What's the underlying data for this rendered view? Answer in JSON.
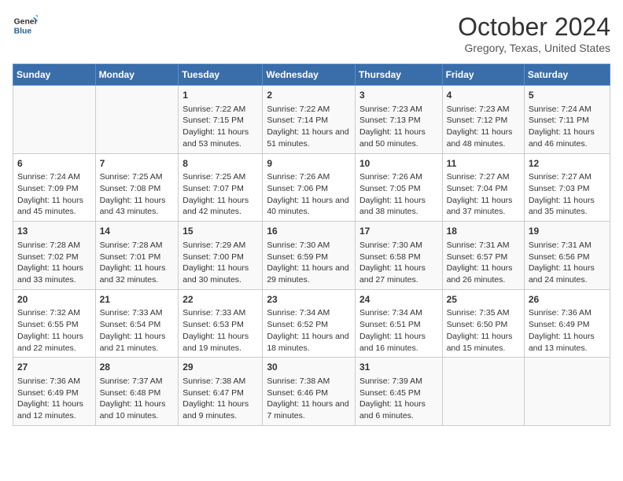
{
  "header": {
    "logo_line1": "General",
    "logo_line2": "Blue",
    "month": "October 2024",
    "location": "Gregory, Texas, United States"
  },
  "columns": [
    "Sunday",
    "Monday",
    "Tuesday",
    "Wednesday",
    "Thursday",
    "Friday",
    "Saturday"
  ],
  "weeks": [
    [
      {
        "day": "",
        "content": ""
      },
      {
        "day": "",
        "content": ""
      },
      {
        "day": "1",
        "content": "Sunrise: 7:22 AM\nSunset: 7:15 PM\nDaylight: 11 hours and 53 minutes."
      },
      {
        "day": "2",
        "content": "Sunrise: 7:22 AM\nSunset: 7:14 PM\nDaylight: 11 hours and 51 minutes."
      },
      {
        "day": "3",
        "content": "Sunrise: 7:23 AM\nSunset: 7:13 PM\nDaylight: 11 hours and 50 minutes."
      },
      {
        "day": "4",
        "content": "Sunrise: 7:23 AM\nSunset: 7:12 PM\nDaylight: 11 hours and 48 minutes."
      },
      {
        "day": "5",
        "content": "Sunrise: 7:24 AM\nSunset: 7:11 PM\nDaylight: 11 hours and 46 minutes."
      }
    ],
    [
      {
        "day": "6",
        "content": "Sunrise: 7:24 AM\nSunset: 7:09 PM\nDaylight: 11 hours and 45 minutes."
      },
      {
        "day": "7",
        "content": "Sunrise: 7:25 AM\nSunset: 7:08 PM\nDaylight: 11 hours and 43 minutes."
      },
      {
        "day": "8",
        "content": "Sunrise: 7:25 AM\nSunset: 7:07 PM\nDaylight: 11 hours and 42 minutes."
      },
      {
        "day": "9",
        "content": "Sunrise: 7:26 AM\nSunset: 7:06 PM\nDaylight: 11 hours and 40 minutes."
      },
      {
        "day": "10",
        "content": "Sunrise: 7:26 AM\nSunset: 7:05 PM\nDaylight: 11 hours and 38 minutes."
      },
      {
        "day": "11",
        "content": "Sunrise: 7:27 AM\nSunset: 7:04 PM\nDaylight: 11 hours and 37 minutes."
      },
      {
        "day": "12",
        "content": "Sunrise: 7:27 AM\nSunset: 7:03 PM\nDaylight: 11 hours and 35 minutes."
      }
    ],
    [
      {
        "day": "13",
        "content": "Sunrise: 7:28 AM\nSunset: 7:02 PM\nDaylight: 11 hours and 33 minutes."
      },
      {
        "day": "14",
        "content": "Sunrise: 7:28 AM\nSunset: 7:01 PM\nDaylight: 11 hours and 32 minutes."
      },
      {
        "day": "15",
        "content": "Sunrise: 7:29 AM\nSunset: 7:00 PM\nDaylight: 11 hours and 30 minutes."
      },
      {
        "day": "16",
        "content": "Sunrise: 7:30 AM\nSunset: 6:59 PM\nDaylight: 11 hours and 29 minutes."
      },
      {
        "day": "17",
        "content": "Sunrise: 7:30 AM\nSunset: 6:58 PM\nDaylight: 11 hours and 27 minutes."
      },
      {
        "day": "18",
        "content": "Sunrise: 7:31 AM\nSunset: 6:57 PM\nDaylight: 11 hours and 26 minutes."
      },
      {
        "day": "19",
        "content": "Sunrise: 7:31 AM\nSunset: 6:56 PM\nDaylight: 11 hours and 24 minutes."
      }
    ],
    [
      {
        "day": "20",
        "content": "Sunrise: 7:32 AM\nSunset: 6:55 PM\nDaylight: 11 hours and 22 minutes."
      },
      {
        "day": "21",
        "content": "Sunrise: 7:33 AM\nSunset: 6:54 PM\nDaylight: 11 hours and 21 minutes."
      },
      {
        "day": "22",
        "content": "Sunrise: 7:33 AM\nSunset: 6:53 PM\nDaylight: 11 hours and 19 minutes."
      },
      {
        "day": "23",
        "content": "Sunrise: 7:34 AM\nSunset: 6:52 PM\nDaylight: 11 hours and 18 minutes."
      },
      {
        "day": "24",
        "content": "Sunrise: 7:34 AM\nSunset: 6:51 PM\nDaylight: 11 hours and 16 minutes."
      },
      {
        "day": "25",
        "content": "Sunrise: 7:35 AM\nSunset: 6:50 PM\nDaylight: 11 hours and 15 minutes."
      },
      {
        "day": "26",
        "content": "Sunrise: 7:36 AM\nSunset: 6:49 PM\nDaylight: 11 hours and 13 minutes."
      }
    ],
    [
      {
        "day": "27",
        "content": "Sunrise: 7:36 AM\nSunset: 6:49 PM\nDaylight: 11 hours and 12 minutes."
      },
      {
        "day": "28",
        "content": "Sunrise: 7:37 AM\nSunset: 6:48 PM\nDaylight: 11 hours and 10 minutes."
      },
      {
        "day": "29",
        "content": "Sunrise: 7:38 AM\nSunset: 6:47 PM\nDaylight: 11 hours and 9 minutes."
      },
      {
        "day": "30",
        "content": "Sunrise: 7:38 AM\nSunset: 6:46 PM\nDaylight: 11 hours and 7 minutes."
      },
      {
        "day": "31",
        "content": "Sunrise: 7:39 AM\nSunset: 6:45 PM\nDaylight: 11 hours and 6 minutes."
      },
      {
        "day": "",
        "content": ""
      },
      {
        "day": "",
        "content": ""
      }
    ]
  ]
}
